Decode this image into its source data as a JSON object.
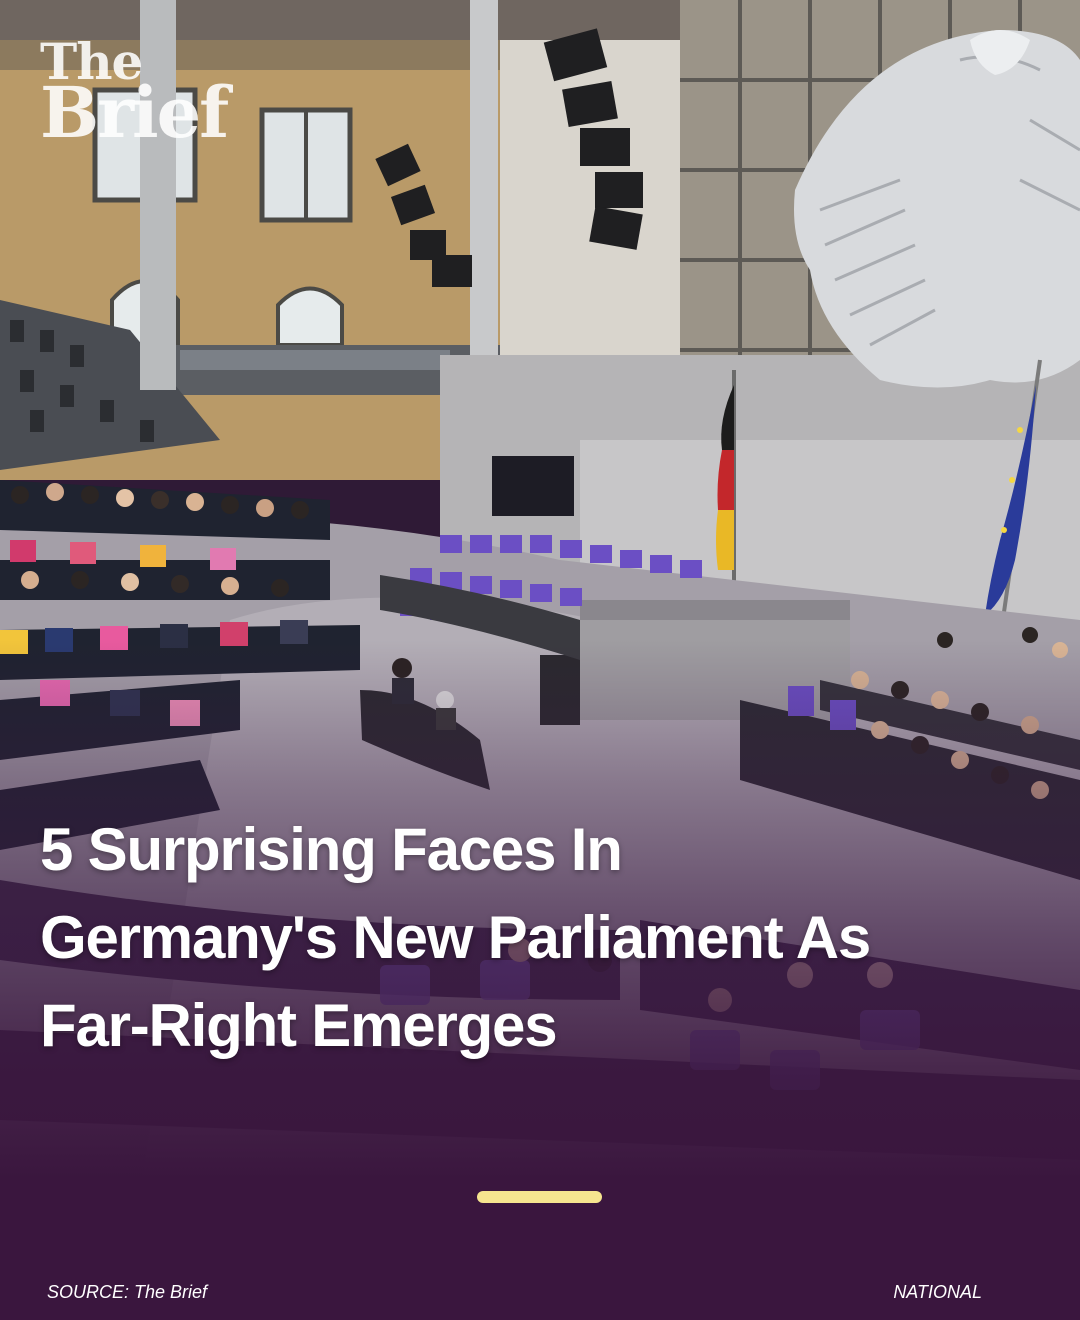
{
  "brand": {
    "logo_line1": "The",
    "logo_line2": "Brief"
  },
  "headline": "5 Surprising Faces In Germany's New Parliament As Far-Right Emerges",
  "footer": {
    "source": "SOURCE: The Brief",
    "category": "NATIONAL"
  },
  "colors": {
    "background_purple": "#3a163e",
    "indicator_yellow": "#f6e58f",
    "seat_purple": "#6b4fc4",
    "text_white": "#ffffff"
  },
  "icons": [
    "eagle-emblem-icon",
    "german-flag-icon",
    "eu-flag-icon"
  ]
}
